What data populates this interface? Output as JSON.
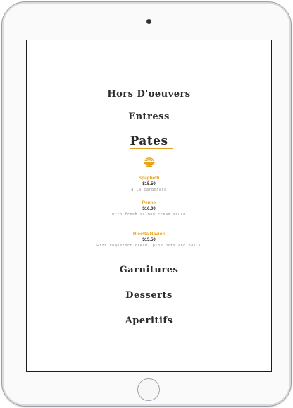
{
  "menu": {
    "sections": [
      {
        "label": "Hors D'oeuvers"
      },
      {
        "label": "Entress"
      },
      {
        "label": "Pates"
      },
      {
        "label": "Garnitures"
      },
      {
        "label": "Desserts"
      },
      {
        "label": "Aperitifs"
      }
    ],
    "active_section_icon": "pasta-bowl-icon",
    "items": [
      {
        "name": "Spaghetti",
        "price": "$15.50",
        "description": "a la carbonara"
      },
      {
        "name": "Penne",
        "price": "$16.00",
        "description": "with fresh salmon cream sauce"
      },
      {
        "name": "Ricotta Ravioli",
        "price": "$15.50",
        "description": "with roquefort cream, pine nuts and basil"
      }
    ]
  },
  "colors": {
    "accent": "#e8a318",
    "title": "#2c2c2c",
    "price": "#222222",
    "description": "#8a8a8a"
  }
}
